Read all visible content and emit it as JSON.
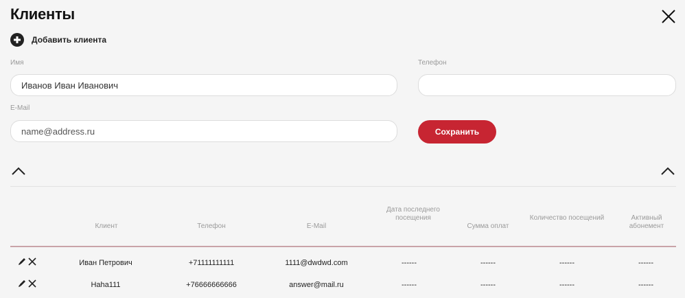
{
  "page": {
    "title": "Клиенты",
    "add_client_label": "Добавить клиента"
  },
  "form": {
    "name_label": "Имя",
    "name_value": "Иванов Иван Иванович",
    "phone_label": "Телефон",
    "phone_value": "",
    "email_label": "E-Mail",
    "email_placeholder": "name@address.ru",
    "save_label": "Сохранить"
  },
  "table": {
    "headers": {
      "client": "Клиент",
      "phone": "Телефон",
      "email": "E-Mail",
      "last_visit": "Дата последнего посещения",
      "payment_sum": "Сумма оплат",
      "visits_count": "Количество посещений",
      "active_subscription": "Активный абонемент"
    },
    "rows": [
      {
        "client": "Иван Петрович",
        "phone": "+71111111111",
        "email": "1111@dwdwd.com",
        "last_visit": "------",
        "payment_sum": "------",
        "visits_count": "------",
        "active_subscription": "------"
      },
      {
        "client": "Haha111",
        "phone": "+76666666666",
        "email": "answer@mail.ru",
        "last_visit": "------",
        "payment_sum": "------",
        "visits_count": "------",
        "active_subscription": "------"
      }
    ]
  },
  "colors": {
    "accent": "#c72532",
    "background": "#f5f5f5",
    "header_line": "#c9a3a8"
  },
  "icons": [
    "close-icon",
    "add-circle-icon",
    "chevron-up-icon",
    "pencil-icon",
    "delete-x-icon"
  ]
}
